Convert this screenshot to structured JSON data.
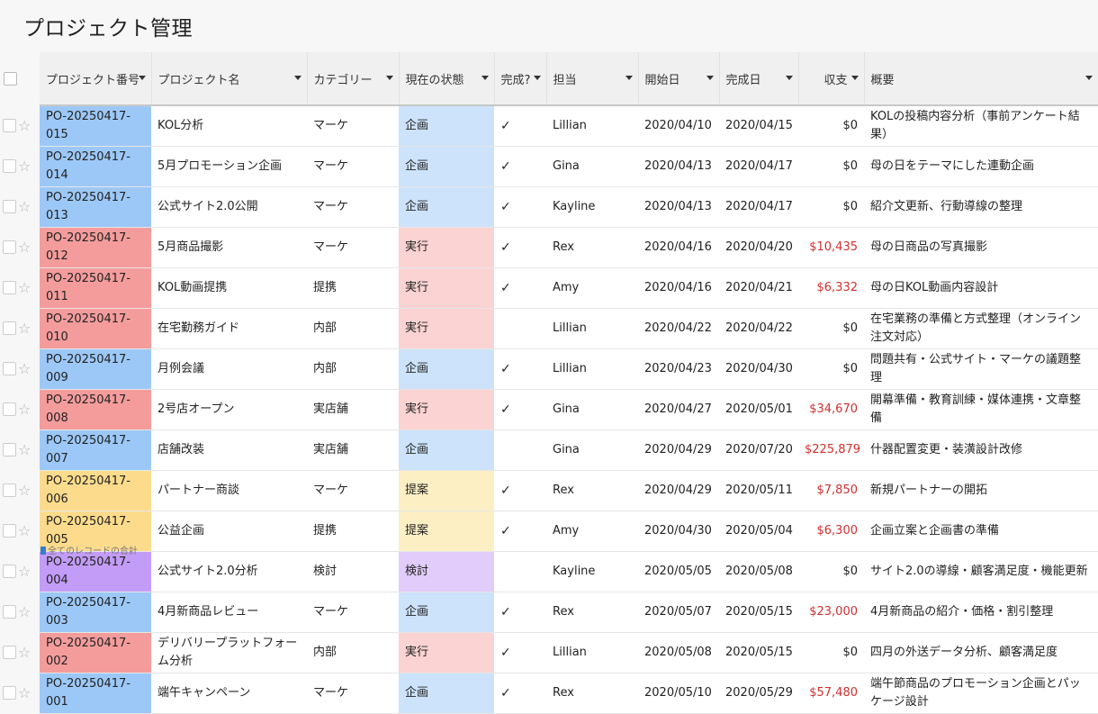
{
  "page": {
    "title": "プロジェクト管理"
  },
  "columns": [
    {
      "key": "number",
      "label": "プロジェクト番号"
    },
    {
      "key": "name",
      "label": "プロジェクト名"
    },
    {
      "key": "category",
      "label": "カテゴリー"
    },
    {
      "key": "status",
      "label": "現在の状態"
    },
    {
      "key": "done",
      "label": "完成?"
    },
    {
      "key": "owner",
      "label": "担当"
    },
    {
      "key": "start",
      "label": "開始日"
    },
    {
      "key": "end",
      "label": "完成日"
    },
    {
      "key": "amount",
      "label": "収支"
    },
    {
      "key": "summary",
      "label": "概要"
    }
  ],
  "colors": {
    "plan_number": "#9cc8f7",
    "plan_status": "#cce3fb",
    "exec_number": "#f49c9c",
    "exec_status": "#fbd3d3",
    "proposal_number": "#fcdc8c",
    "proposal_status": "#fdefc4",
    "review_number": "#c29cf6",
    "review_status": "#e2ccfb",
    "negative": "#d03030"
  },
  "rows": [
    {
      "number": "PO-20250417-015",
      "name": "KOL分析",
      "category": "マーケ",
      "status": "企画",
      "status_key": "plan",
      "done": "✓",
      "owner": "Lillian",
      "start": "2020/04/10",
      "end": "2020/04/15",
      "amount": "$0",
      "negative": false,
      "summary": "KOLの投稿内容分析（事前アンケート結果）"
    },
    {
      "number": "PO-20250417-014",
      "name": "5月プロモーション企画",
      "category": "マーケ",
      "status": "企画",
      "status_key": "plan",
      "done": "✓",
      "owner": "Gina",
      "start": "2020/04/13",
      "end": "2020/04/17",
      "amount": "$0",
      "negative": false,
      "summary": "母の日をテーマにした連動企画"
    },
    {
      "number": "PO-20250417-013",
      "name": "公式サイト2.0公開",
      "category": "マーケ",
      "status": "企画",
      "status_key": "plan",
      "done": "✓",
      "owner": "Kayline",
      "start": "2020/04/13",
      "end": "2020/04/17",
      "amount": "$0",
      "negative": false,
      "summary": "紹介文更新、行動導線の整理"
    },
    {
      "number": "PO-20250417-012",
      "name": "5月商品撮影",
      "category": "マーケ",
      "status": "実行",
      "status_key": "exec",
      "done": "✓",
      "owner": "Rex",
      "start": "2020/04/16",
      "end": "2020/04/20",
      "amount": "$10,435",
      "negative": true,
      "summary": "母の日商品の写真撮影"
    },
    {
      "number": "PO-20250417-011",
      "name": "KOL動画提携",
      "category": "提携",
      "status": "実行",
      "status_key": "exec",
      "done": "✓",
      "owner": "Amy",
      "start": "2020/04/16",
      "end": "2020/04/21",
      "amount": "$6,332",
      "negative": true,
      "summary": "母の日KOL動画内容設計"
    },
    {
      "number": "PO-20250417-010",
      "name": "在宅勤務ガイド",
      "category": "内部",
      "status": "実行",
      "status_key": "exec",
      "done": "",
      "owner": "Lillian",
      "start": "2020/04/22",
      "end": "2020/04/22",
      "amount": "$0",
      "negative": false,
      "summary": "在宅業務の準備と方式整理（オンライン注文対応）"
    },
    {
      "number": "PO-20250417-009",
      "name": "月例会議",
      "category": "内部",
      "status": "企画",
      "status_key": "plan",
      "done": "✓",
      "owner": "Lillian",
      "start": "2020/04/23",
      "end": "2020/04/30",
      "amount": "$0",
      "negative": false,
      "summary": "問題共有・公式サイト・マーケの議題整理"
    },
    {
      "number": "PO-20250417-008",
      "name": "2号店オープン",
      "category": "実店舗",
      "status": "実行",
      "status_key": "exec",
      "done": "✓",
      "owner": "Gina",
      "start": "2020/04/27",
      "end": "2020/05/01",
      "amount": "$34,670",
      "negative": true,
      "summary": "開幕準備・教育訓練・媒体連携・文章整備"
    },
    {
      "number": "PO-20250417-007",
      "name": "店舗改装",
      "category": "実店舗",
      "status": "企画",
      "status_key": "plan",
      "done": "",
      "owner": "Gina",
      "start": "2020/04/29",
      "end": "2020/07/20",
      "amount": "$225,879",
      "negative": true,
      "summary": "什器配置変更・装潢設計改修"
    },
    {
      "number": "PO-20250417-006",
      "name": "パートナー商談",
      "category": "マーケ",
      "status": "提案",
      "status_key": "proposal",
      "done": "✓",
      "owner": "Rex",
      "start": "2020/04/29",
      "end": "2020/05/11",
      "amount": "$7,850",
      "negative": true,
      "summary": "新規パートナーの開拓"
    },
    {
      "number": "PO-20250417-005",
      "name": "公益企画",
      "category": "提携",
      "status": "提案",
      "status_key": "proposal",
      "done": "✓",
      "owner": "Amy",
      "start": "2020/04/30",
      "end": "2020/05/04",
      "amount": "$6,300",
      "negative": true,
      "summary": "企画立案と企画書の準備"
    },
    {
      "number": "PO-20250417-004",
      "name": "公式サイト2.0分析",
      "category": "検討",
      "status": "検討",
      "status_key": "review",
      "done": "",
      "owner": "Kayline",
      "start": "2020/05/05",
      "end": "2020/05/08",
      "amount": "$0",
      "negative": false,
      "summary": "サイト2.0の導線・顧客満足度・機能更新"
    },
    {
      "number": "PO-20250417-003",
      "name": "4月新商品レビュー",
      "category": "マーケ",
      "status": "企画",
      "status_key": "plan",
      "done": "✓",
      "owner": "Rex",
      "start": "2020/05/07",
      "end": "2020/05/15",
      "amount": "$23,000",
      "negative": true,
      "summary": "4月新商品の紹介・価格・割引整理"
    },
    {
      "number": "PO-20250417-002",
      "name": "デリバリープラットフォーム分析",
      "category": "内部",
      "status": "実行",
      "status_key": "exec",
      "done": "✓",
      "owner": "Lillian",
      "start": "2020/05/08",
      "end": "2020/05/15",
      "amount": "$0",
      "negative": false,
      "summary": "四月の外送データ分析、顧客満足度"
    },
    {
      "number": "PO-20250417-001",
      "name": "端午キャンペーン",
      "category": "マーケ",
      "status": "企画",
      "status_key": "plan",
      "done": "✓",
      "owner": "Rex",
      "start": "2020/05/10",
      "end": "2020/05/29",
      "amount": "$57,480",
      "negative": true,
      "summary": "端午節商品のプロモーション企画とパッケージ設計"
    }
  ],
  "footer": {
    "totals_label": "全てのレコードの合計"
  },
  "icons": {
    "select": "checkbox-icon",
    "favorite": "star-icon",
    "sort": "caret-down-icon",
    "totals": "document-icon"
  }
}
